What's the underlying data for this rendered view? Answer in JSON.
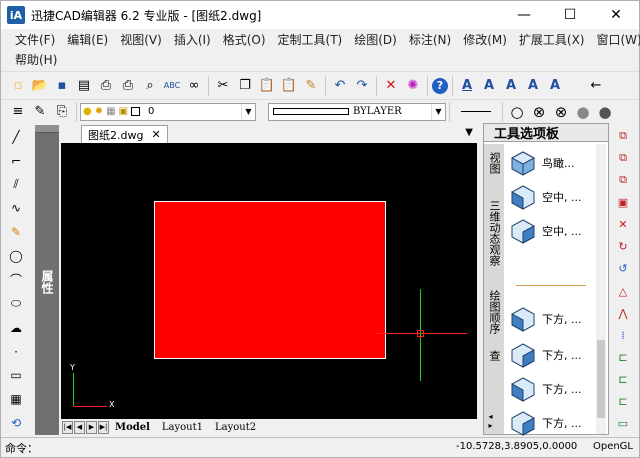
{
  "app": {
    "logo_text": "iA",
    "title": "迅捷CAD编辑器 6.2 专业版 - [图纸2.dwg]"
  },
  "window_controls": {
    "minimize": "—",
    "maximize": "☐",
    "close": "✕"
  },
  "menu_row1": [
    "文件(F)",
    "编辑(E)",
    "视图(V)",
    "插入(I)",
    "格式(O)",
    "定制工具(T)",
    "绘图(D)",
    "标注(N)",
    "修改(M)",
    "扩展工具(X)",
    "窗口(W)"
  ],
  "menu_row2": [
    "帮助(H)"
  ],
  "toolbar1": [
    "new-icon",
    "open-icon",
    "save-icon",
    "print-preview-icon",
    "print-icon",
    "plot-icon",
    "find-icon",
    "spell-check-icon",
    "binoculars-icon",
    "cut-icon",
    "copy-icon",
    "paste-icon",
    "paste-special-icon",
    "match-prop-icon",
    "undo-icon",
    "redo-icon",
    "delete-icon",
    "erase-icon",
    "help-icon",
    "text-icon",
    "text-style-icon",
    "text-edit-icon",
    "text-find-icon",
    "text-zoom-icon"
  ],
  "toolbar2": {
    "layer_value": "0",
    "linetype_value": "BYLAYER"
  },
  "document": {
    "tab": "图纸2.dwg",
    "close": "✕"
  },
  "layout_tabs": [
    "Model",
    "Layout1",
    "Layout2"
  ],
  "properties_panel": {
    "label": "属性"
  },
  "tool_palette": {
    "title": "工具选项板",
    "vertical_tabs": [
      "视图",
      "三维动态观察",
      "绘图顺序",
      "查"
    ],
    "items": [
      "鸟瞰...",
      "空中, ...",
      "空中, ...",
      "下方, ...",
      "下方, ...",
      "下方, ...",
      "下方, ..."
    ]
  },
  "ucs": {
    "x": "X",
    "y": "Y"
  },
  "status": {
    "command": "命令：",
    "coordinates": "-10.5728,3.8905,0.0000",
    "renderer": "OpenGL"
  },
  "colors": {
    "rectangle": "#ff0000",
    "canvas": "#000000",
    "crosshair_x": "#ff2020",
    "crosshair_y": "#20d020"
  }
}
